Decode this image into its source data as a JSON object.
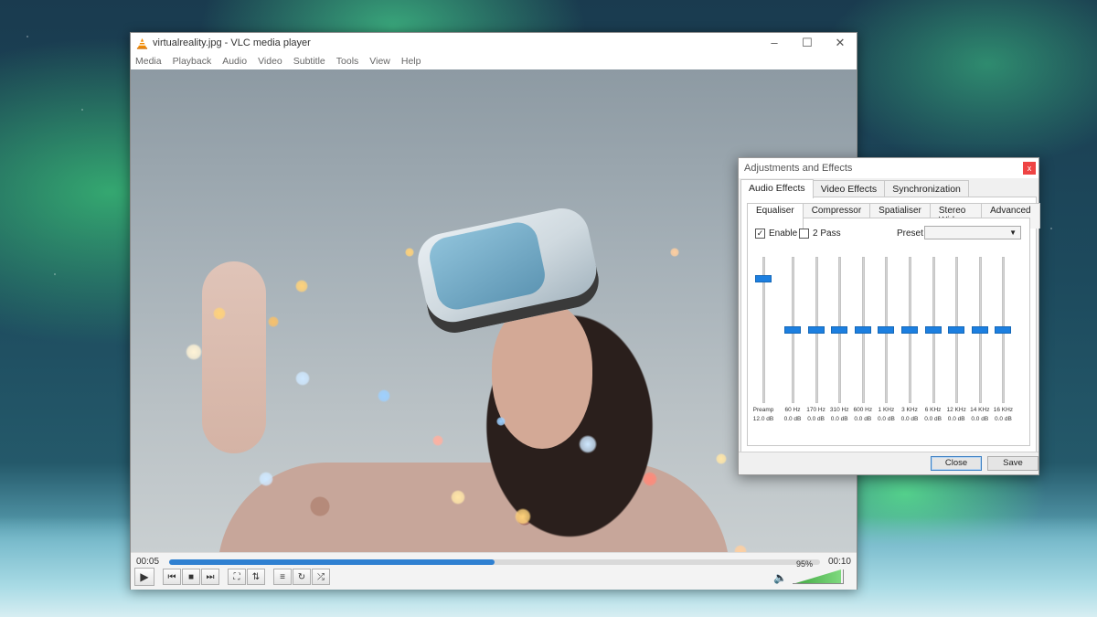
{
  "vlc": {
    "title": "virtualreality.jpg - VLC media player",
    "menu": [
      "Media",
      "Playback",
      "Audio",
      "Video",
      "Subtitle",
      "Tools",
      "View",
      "Help"
    ],
    "time_elapsed": "00:05",
    "time_total": "00:10",
    "progress_fraction": 0.5,
    "volume_percent": "95%"
  },
  "dialog": {
    "title": "Adjustments and Effects",
    "close_x": "x",
    "tabs": [
      "Audio Effects",
      "Video Effects",
      "Synchronization"
    ],
    "subtabs": [
      "Equaliser",
      "Compressor",
      "Spatialiser",
      "Stereo Widener",
      "Advanced"
    ],
    "enable_label": "Enable",
    "enable_checked": true,
    "two_pass_label": "2 Pass",
    "two_pass_checked": false,
    "preset_label": "Preset",
    "preset_value": "",
    "preamp": {
      "label": "Preamp",
      "value": "12.0 dB",
      "level": 0.85
    },
    "bands": [
      {
        "freq": "60 Hz",
        "value": "0.0 dB",
        "level": 0.5
      },
      {
        "freq": "170 Hz",
        "value": "0.0 dB",
        "level": 0.5
      },
      {
        "freq": "310 Hz",
        "value": "0.0 dB",
        "level": 0.5
      },
      {
        "freq": "600 Hz",
        "value": "0.0 dB",
        "level": 0.5
      },
      {
        "freq": "1 KHz",
        "value": "0.0 dB",
        "level": 0.5
      },
      {
        "freq": "3 KHz",
        "value": "0.0 dB",
        "level": 0.5
      },
      {
        "freq": "6 KHz",
        "value": "0.0 dB",
        "level": 0.5
      },
      {
        "freq": "12 KHz",
        "value": "0.0 dB",
        "level": 0.5
      },
      {
        "freq": "14 KHz",
        "value": "0.0 dB",
        "level": 0.5
      },
      {
        "freq": "16 KHz",
        "value": "0.0 dB",
        "level": 0.5
      }
    ],
    "close_label": "Close",
    "save_label": "Save"
  },
  "icons": {
    "app": "vlc-cone-icon",
    "play": "play-icon",
    "prev": "previous-icon",
    "stop": "stop-icon",
    "next": "next-icon",
    "fullscreen": "fullscreen-icon",
    "extended": "equalizer-icon",
    "playlist": "playlist-icon",
    "loop": "loop-icon",
    "shuffle": "shuffle-icon",
    "volume": "speaker-icon"
  },
  "colors": {
    "accent": "#1c7fe0",
    "seek_fill": "#2f80d1",
    "volume_fill": "#3fa63f",
    "dialog_close": "#e44444"
  }
}
